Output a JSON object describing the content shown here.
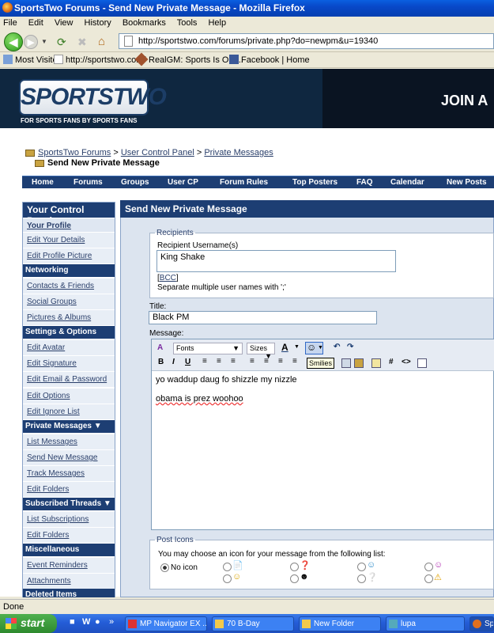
{
  "browser": {
    "window_title": "SportsTwo Forums - Send New Private Message - Mozilla Firefox",
    "menu": [
      "File",
      "Edit",
      "View",
      "History",
      "Bookmarks",
      "Tools",
      "Help"
    ],
    "url": "http://sportstwo.com/forums/private.php?do=newpm&u=19340",
    "bookmarks": [
      "Most Visited",
      "http://sportstwo.com/",
      "RealGM: Sports Is Our...",
      "Facebook | Home"
    ],
    "status": "Done"
  },
  "site": {
    "logo_text": "SPORTSTWO",
    "tagline": "FOR SPORTS FANS BY SPORTS FANS",
    "banner_text": "JOIN A",
    "breadcrumb": [
      "SportsTwo Forums",
      "User Control Panel",
      "Private Messages"
    ],
    "page_title": "Send New Private Message",
    "nav": [
      "Home",
      "Forums",
      "Groups",
      "User CP",
      "Forum Rules",
      "Top Posters",
      "FAQ",
      "Calendar",
      "New Posts"
    ]
  },
  "sidebar": {
    "title": "Your Control Panel",
    "sections": [
      {
        "label": "Your Profile",
        "items": [
          "Edit Your Details",
          "Edit Profile Picture"
        ]
      },
      {
        "label": "Networking",
        "items": [
          "Contacts & Friends",
          "Social Groups",
          "Pictures & Albums"
        ]
      },
      {
        "label": "Settings & Options",
        "items": [
          "Edit Avatar",
          "Edit Signature",
          "Edit Email & Password",
          "Edit Options",
          "Edit Ignore List"
        ]
      },
      {
        "label": "Private Messages",
        "items": [
          "List Messages",
          "Send New Message",
          "Track Messages",
          "Edit Folders"
        ]
      },
      {
        "label": "Subscribed Threads",
        "items": [
          "List Subscriptions",
          "Edit Folders"
        ]
      },
      {
        "label": "Miscellaneous",
        "items": [
          "Event Reminders",
          "Attachments"
        ]
      },
      {
        "label": "Deleted Items",
        "items": []
      }
    ]
  },
  "form": {
    "panel_title": "Send New Private Message",
    "recipients_legend": "Recipients",
    "recipient_label": "Recipient Username(s)",
    "recipient_value": "King Shake",
    "bcc_link": "BCC",
    "recipient_hint": "Separate multiple user names with ';'",
    "title_label": "Title:",
    "title_value": "Black PM",
    "message_label": "Message:",
    "font_select": "Fonts",
    "size_select": "Sizes",
    "smilies_tooltip": "Smilies",
    "message_lines": [
      "yo waddup daug fo shizzle my nizzle",
      "obama is prez woohoo"
    ],
    "post_icons_legend": "Post Icons",
    "post_icons_hint": "You may choose an icon for your message from the following list:",
    "no_icon_label": "No icon"
  },
  "taskbar": {
    "start": "start",
    "tasks": [
      "MP Navigator EX ...",
      "70 B-Day",
      "New Folder",
      "lupa",
      "Sp"
    ]
  },
  "colors": {
    "nav_blue": "#1d3e73",
    "header_dark": "#0f2740",
    "panel_bg": "#dce4ef"
  }
}
